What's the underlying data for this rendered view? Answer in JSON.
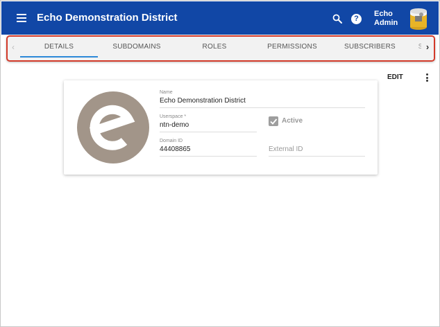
{
  "header": {
    "title": "Echo Demonstration District",
    "user_name": "Echo Admin",
    "colors": {
      "app_bar": "#1147a6",
      "tab_indicator": "#2b88d8",
      "highlight_border": "#d33a2a"
    }
  },
  "tabs": [
    {
      "label": "DETAILS",
      "active": true
    },
    {
      "label": "SUBDOMAINS",
      "active": false
    },
    {
      "label": "ROLES",
      "active": false
    },
    {
      "label": "PERMISSIONS",
      "active": false
    },
    {
      "label": "SUBSCRIBERS",
      "active": false
    }
  ],
  "tab_scroll": {
    "left": "‹",
    "right": "›"
  },
  "actions": {
    "edit_label": "EDIT"
  },
  "details": {
    "name_label": "Name",
    "name_value": "Echo Demonstration District",
    "userspace_label": "Userspace *",
    "userspace_value": "ntn-demo",
    "domain_id_label": "Domain ID",
    "domain_id_value": "44408865",
    "active_label": "Active",
    "active_checked": true,
    "external_id_placeholder": "External ID"
  },
  "icons": {
    "menu": "menu-icon",
    "search": "search-icon",
    "help": "help-icon",
    "help_glyph": "?",
    "more": "more-vert-icon",
    "check": "check-icon",
    "logo": "echo-logo-icon"
  }
}
